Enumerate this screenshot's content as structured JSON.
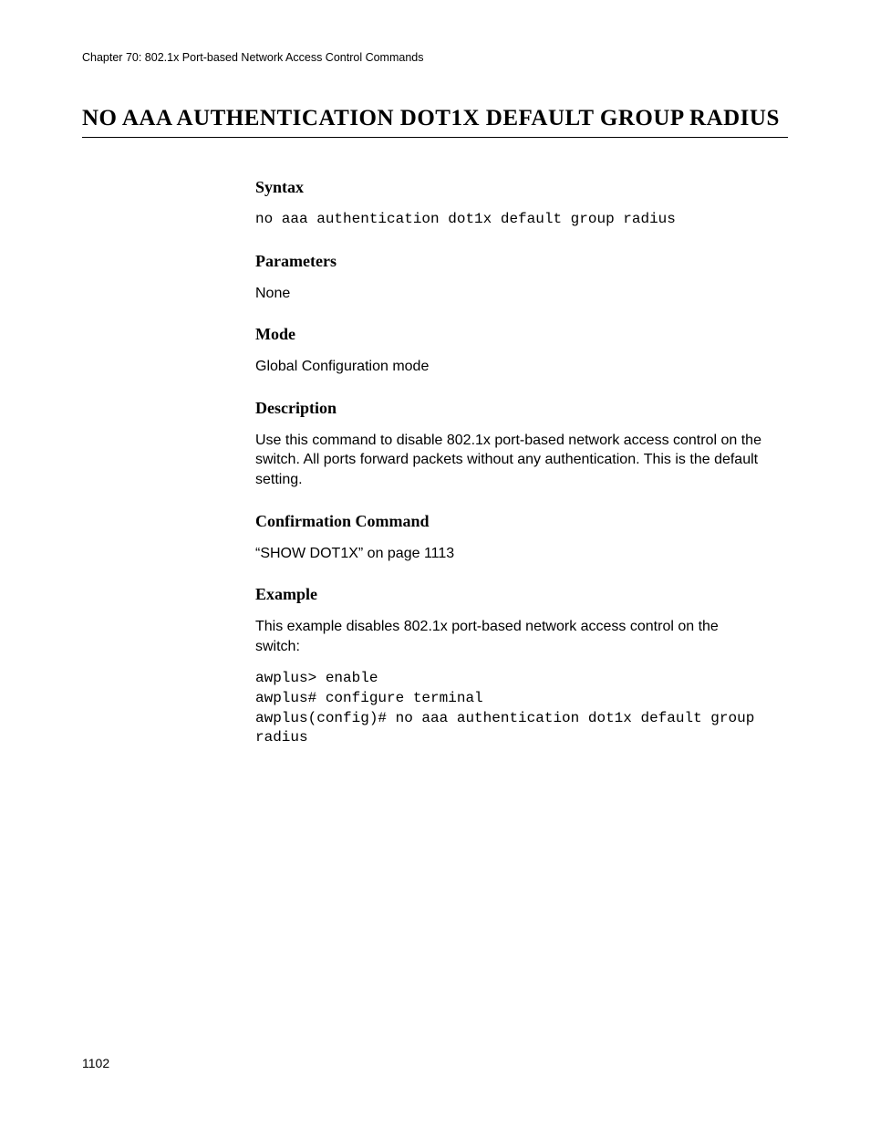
{
  "header": {
    "running": "Chapter 70: 802.1x Port-based Network Access Control Commands"
  },
  "title": "NO AAA AUTHENTICATION DOT1X DEFAULT GROUP RADIUS",
  "sections": {
    "syntax": {
      "head": "Syntax",
      "code": "no aaa authentication dot1x default group radius"
    },
    "parameters": {
      "head": "Parameters",
      "text": "None"
    },
    "mode": {
      "head": "Mode",
      "text": "Global Configuration mode"
    },
    "description": {
      "head": "Description",
      "text": "Use this command to disable 802.1x port-based network access control on the switch. All ports forward packets without any authentication. This is the default setting."
    },
    "confirmation": {
      "head": "Confirmation Command",
      "text": "“SHOW DOT1X” on page 1113"
    },
    "example": {
      "head": "Example",
      "intro": "This example disables 802.1x port-based network access control on the switch:",
      "code": "awplus> enable\nawplus# configure terminal\nawplus(config)# no aaa authentication dot1x default group radius"
    }
  },
  "page_number": "1102"
}
